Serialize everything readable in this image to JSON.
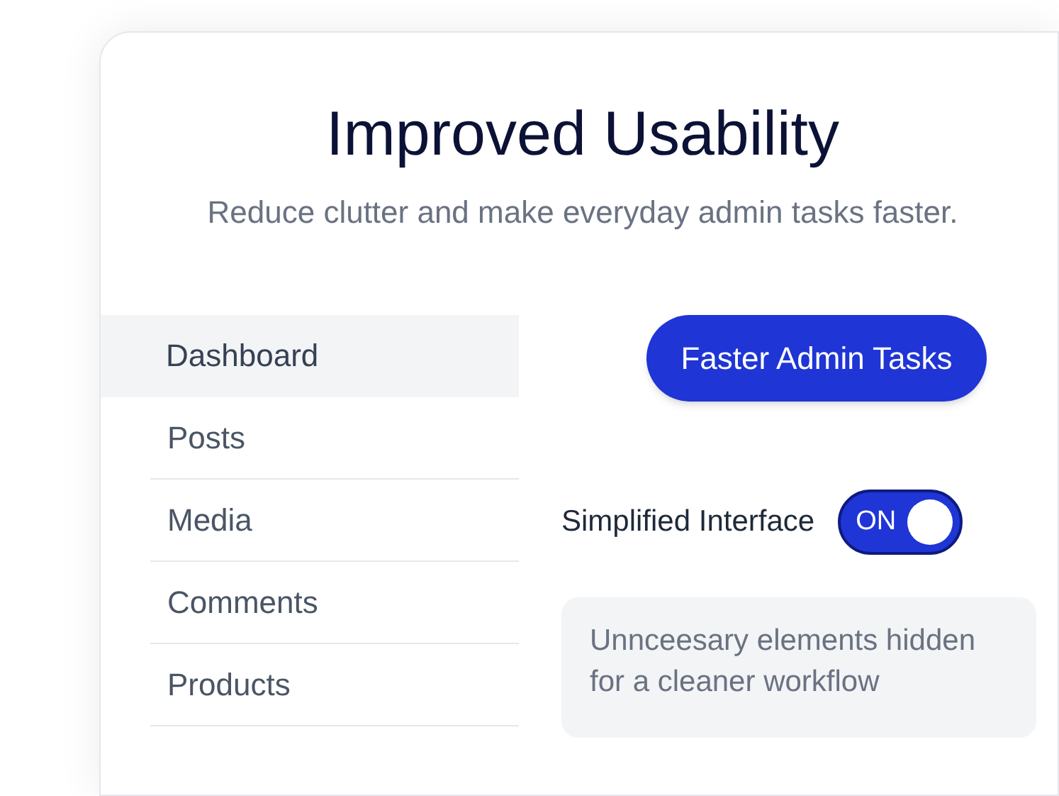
{
  "header": {
    "title": "Improved Usability",
    "subtitle": "Reduce clutter and make everyday admin tasks faster."
  },
  "sidebar": {
    "items": [
      {
        "label": "Dashboard",
        "selected": true
      },
      {
        "label": "Posts",
        "selected": false
      },
      {
        "label": "Media",
        "selected": false
      },
      {
        "label": "Comments",
        "selected": false
      },
      {
        "label": "Products",
        "selected": false
      }
    ]
  },
  "action_button": {
    "label": "Faster Admin Tasks"
  },
  "toggle": {
    "label": "Simplified Interface",
    "on": true,
    "state_text": "ON"
  },
  "note": "Unnceesary elements hidden for a cleaner workflow"
}
